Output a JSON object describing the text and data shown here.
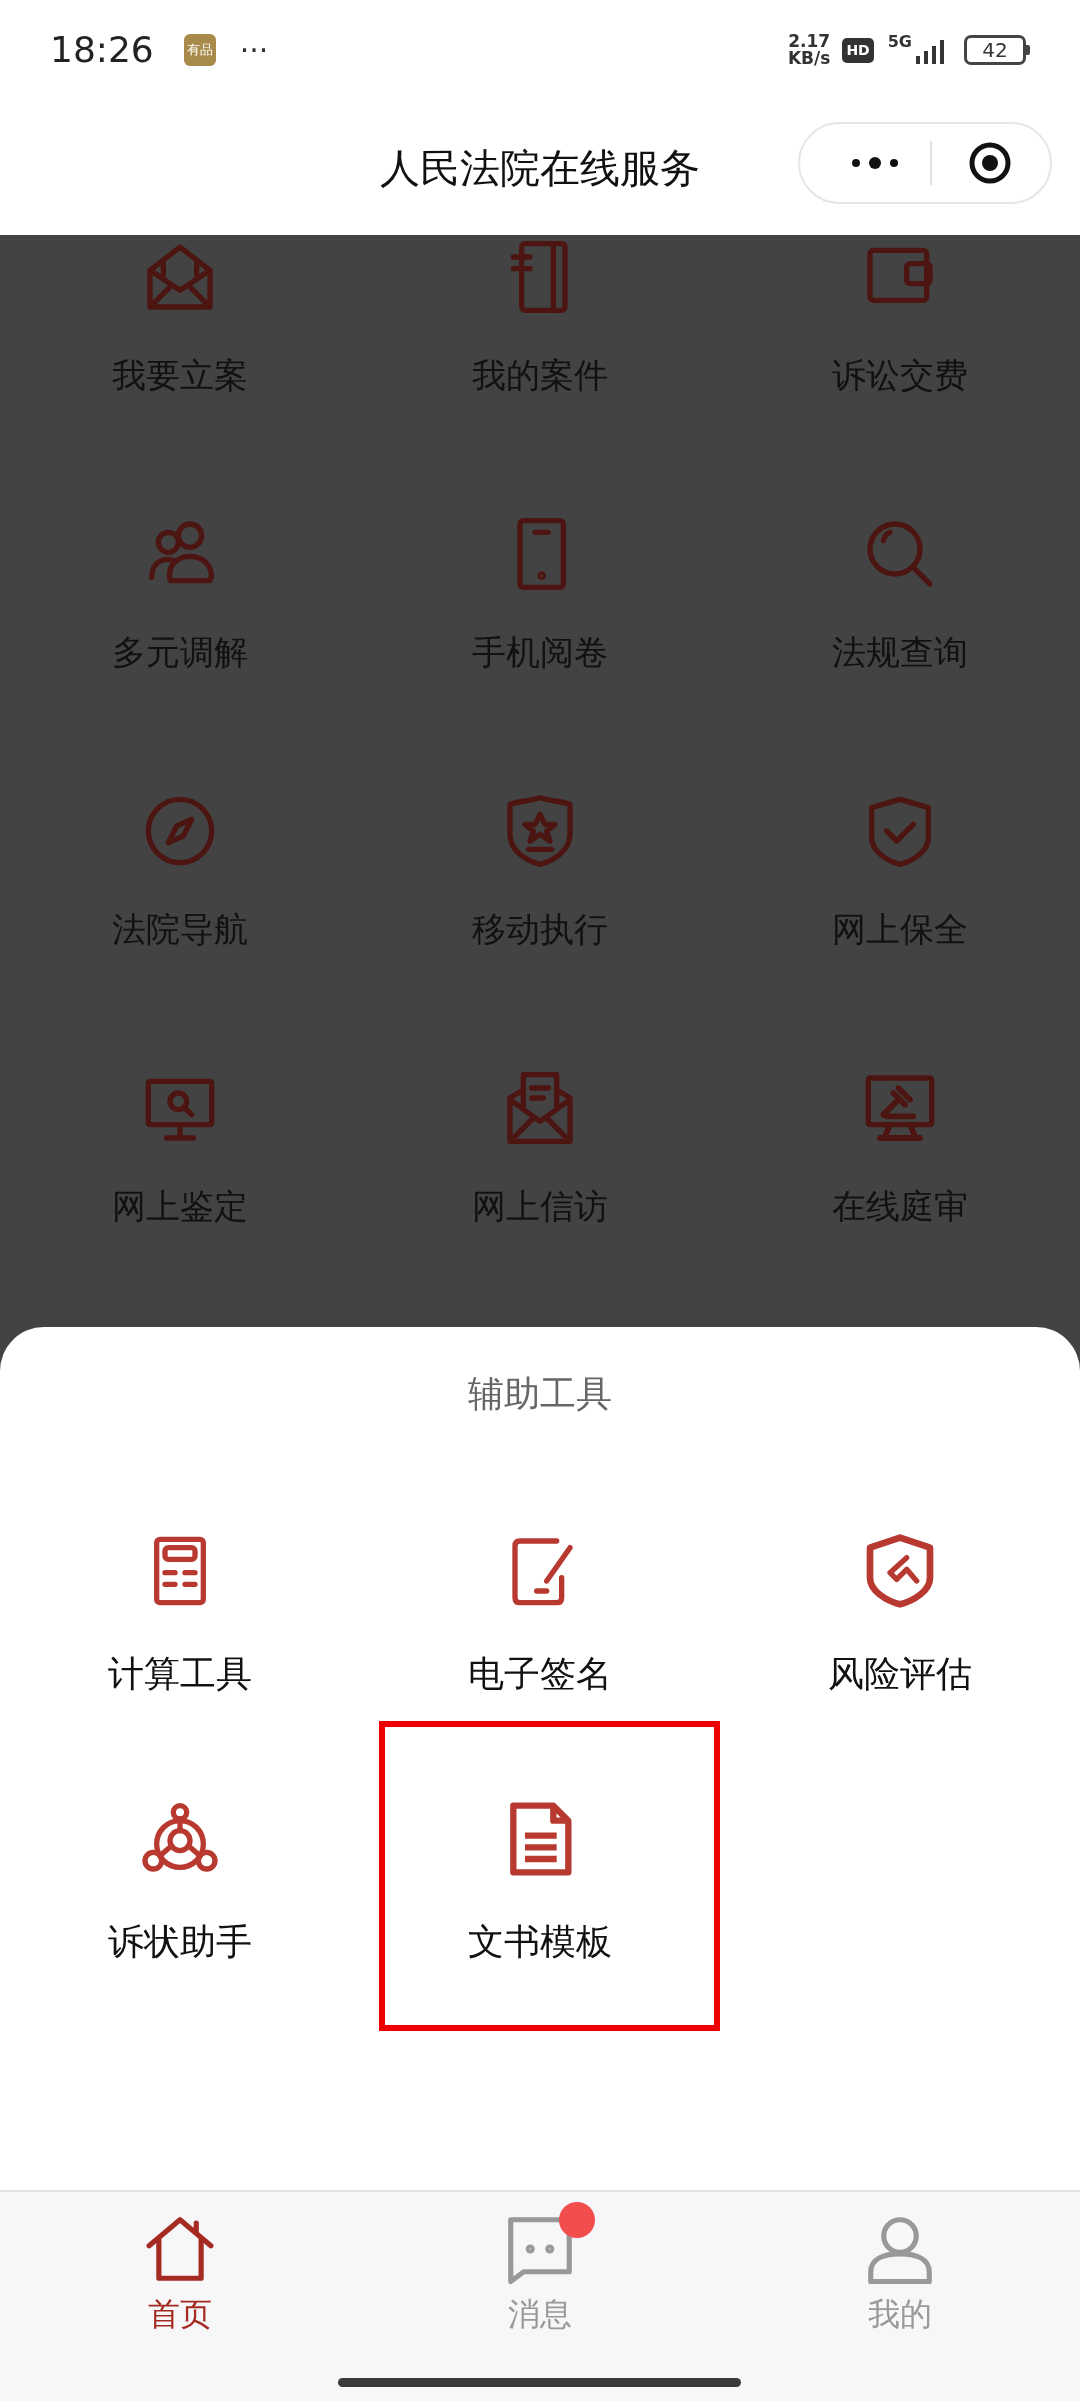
{
  "status_bar": {
    "time": "18:26",
    "app_badge": "有品",
    "more": "···",
    "net_speed": [
      "2.17",
      "KB/s"
    ],
    "hd": "HD",
    "network": "5G",
    "battery": "42"
  },
  "header": {
    "title": "人民法院在线服务"
  },
  "services": [
    {
      "label": "我要立案"
    },
    {
      "label": "我的案件"
    },
    {
      "label": "诉讼交费"
    },
    {
      "label": "多元调解"
    },
    {
      "label": "手机阅卷"
    },
    {
      "label": "法规查询"
    },
    {
      "label": "法院导航"
    },
    {
      "label": "移动执行"
    },
    {
      "label": "网上保全"
    },
    {
      "label": "网上鉴定"
    },
    {
      "label": "网上信访"
    },
    {
      "label": "在线庭审"
    }
  ],
  "sheet": {
    "title": "辅助工具",
    "tools": [
      {
        "label": "计算工具",
        "highlighted": false
      },
      {
        "label": "电子签名",
        "highlighted": false
      },
      {
        "label": "风险评估",
        "highlighted": false
      },
      {
        "label": "诉状助手",
        "highlighted": false
      },
      {
        "label": "文书模板",
        "highlighted": true
      }
    ]
  },
  "tab_bar": [
    {
      "label": "首页",
      "selected": true,
      "badge": false
    },
    {
      "label": "消息",
      "selected": false,
      "badge": true
    },
    {
      "label": "我的",
      "selected": false,
      "badge": false
    }
  ]
}
